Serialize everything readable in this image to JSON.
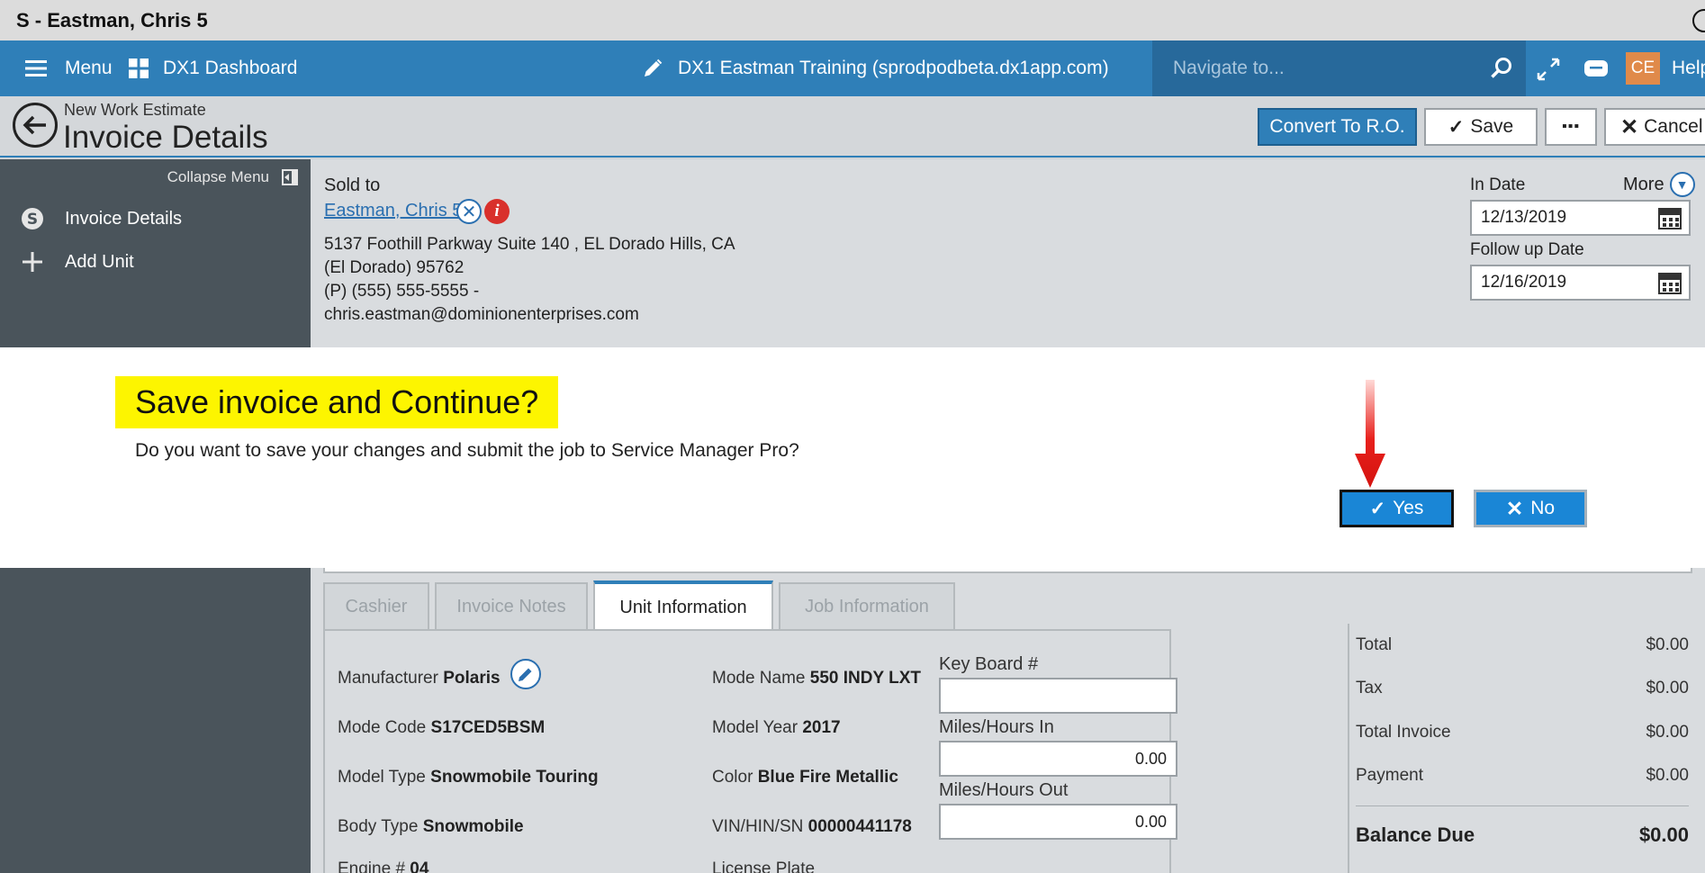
{
  "window": {
    "title": "S - Eastman, Chris 5"
  },
  "topnav": {
    "menu_label": "Menu",
    "dashboard_label": "DX1 Dashboard",
    "site_label": "DX1 Eastman Training (sprodpodbeta.dx1app.com)",
    "search_placeholder": "Navigate to...",
    "user_initials": "CE",
    "help_label": "Help"
  },
  "header": {
    "breadcrumb": "New Work Estimate",
    "title": "Invoice Details",
    "convert_label": "Convert To R.O.",
    "save_label": "Save",
    "more_label": "▪▪▪",
    "cancel_label": "Cancel"
  },
  "sidebar": {
    "collapse_label": "Collapse Menu",
    "items": [
      {
        "label": "Invoice Details",
        "icon": "dollar-circle-icon"
      },
      {
        "label": "Add Unit",
        "icon": "plus-icon"
      }
    ]
  },
  "customer": {
    "sold_to_label": "Sold to",
    "name": "Eastman, Chris 5",
    "address_line1": "5137 Foothill Parkway Suite 140 , EL Dorado Hills, CA",
    "address_line2": "(El Dorado) 95762",
    "phone": "(P) (555) 555-5555 -",
    "email": "chris.eastman@dominionenterprises.com"
  },
  "dates": {
    "more_label": "More",
    "in_date_label": "In Date",
    "in_date": "12/13/2019",
    "follow_up_label": "Follow up Date",
    "follow_up": "12/16/2019"
  },
  "tabs": [
    {
      "label": "Cashier",
      "active": false
    },
    {
      "label": "Invoice Notes",
      "active": false
    },
    {
      "label": "Unit Information",
      "active": true
    },
    {
      "label": "Job Information",
      "active": false
    }
  ],
  "unit": {
    "manufacturer_label": "Manufacturer",
    "manufacturer": "Polaris",
    "mode_name_label": "Mode Name",
    "mode_name": "550 INDY LXT",
    "mode_code_label": "Mode Code",
    "mode_code": "S17CED5BSM",
    "model_year_label": "Model Year",
    "model_year": "2017",
    "model_type_label": "Model Type",
    "model_type": "Snowmobile Touring",
    "color_label": "Color",
    "color": "Blue Fire Metallic",
    "body_type_label": "Body Type",
    "body_type": "Snowmobile",
    "vin_label": "VIN/HIN/SN",
    "vin": "00000441178",
    "engine_label": "Engine #",
    "engine": "04",
    "license_label": "License Plate",
    "keyboard_label": "Key Board #",
    "keyboard_value": "",
    "miles_in_label": "Miles/Hours In",
    "miles_in": "0.00",
    "miles_out_label": "Miles/Hours Out",
    "miles_out": "0.00"
  },
  "totals": {
    "total_label": "Total",
    "total": "$0.00",
    "tax_label": "Tax",
    "tax": "$0.00",
    "total_invoice_label": "Total Invoice",
    "total_invoice": "$0.00",
    "payment_label": "Payment",
    "payment": "$0.00",
    "balance_label": "Balance Due",
    "balance": "$0.00"
  },
  "dialog": {
    "title": "Save invoice and Continue?",
    "message": "Do you want to save your changes and submit the job to Service Manager Pro?",
    "yes_label": "Yes",
    "no_label": "No",
    "highlight_color": "#fdf500",
    "arrow_color": "#e8201c"
  },
  "colors": {
    "brand": "#2f7fb8",
    "sidebar": "#4a545b",
    "button": "#1a86d6"
  }
}
